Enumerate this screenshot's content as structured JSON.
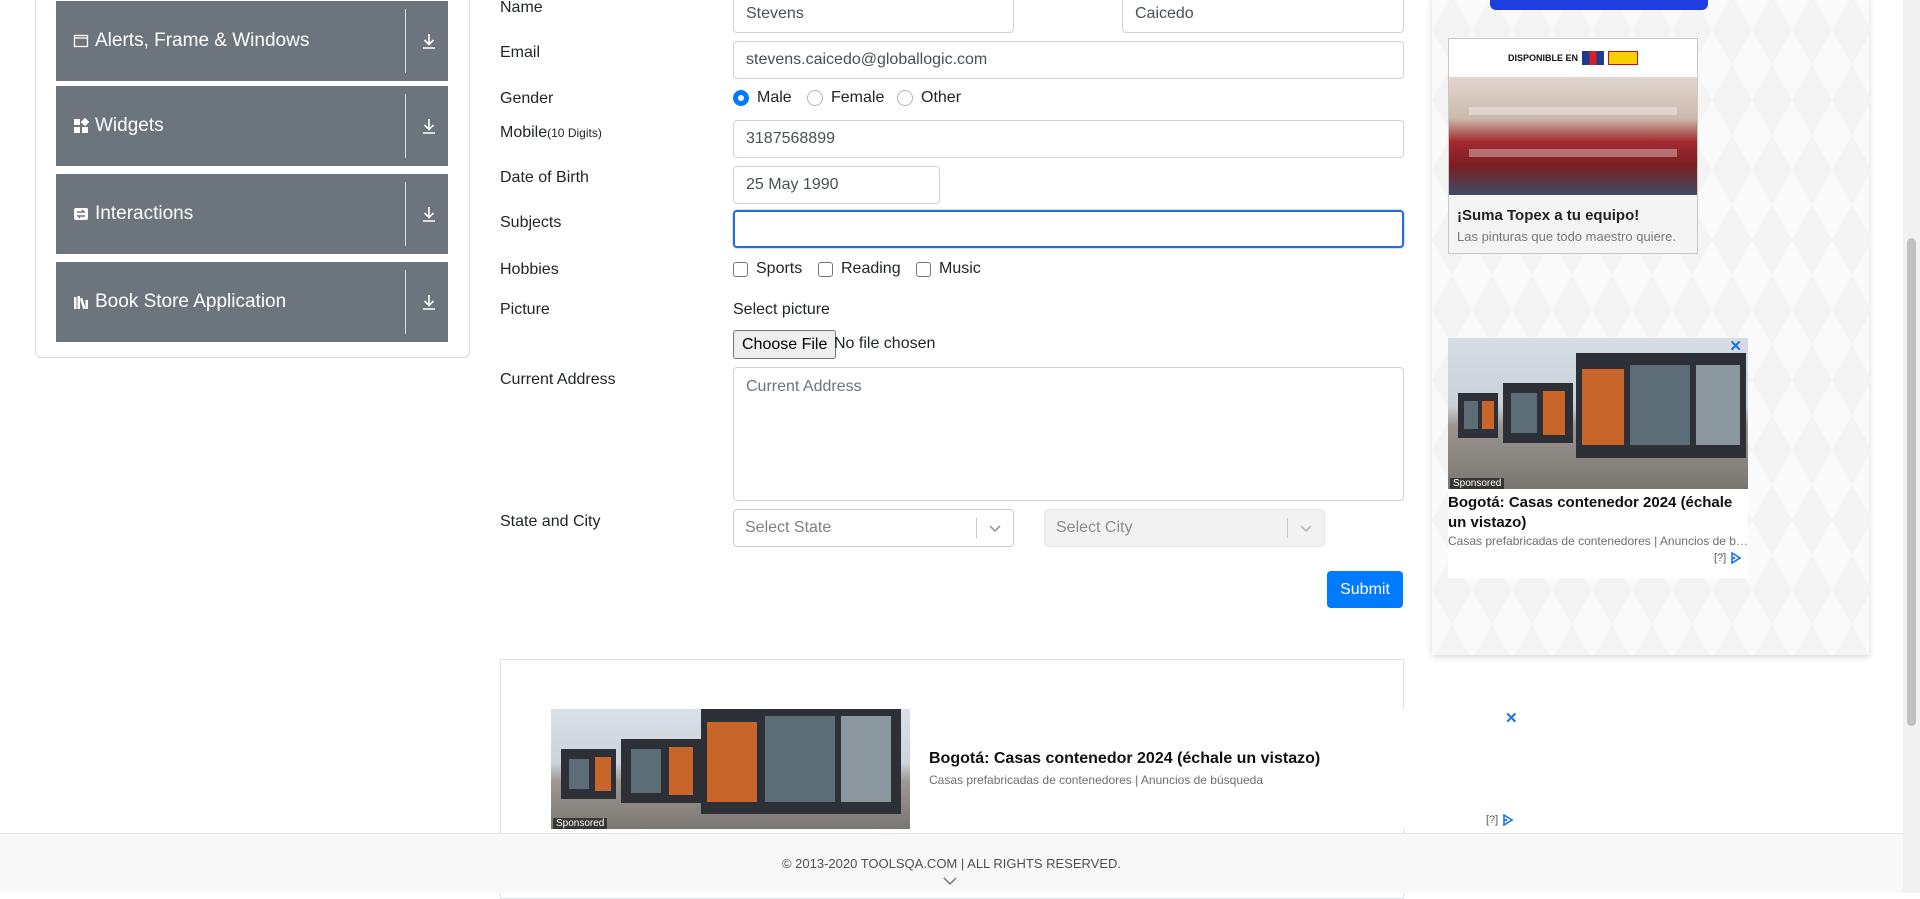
{
  "sidebar": {
    "groups": [
      {
        "label": "Alerts, Frame & Windows",
        "icon": "window-icon"
      },
      {
        "label": "Widgets",
        "icon": "widgets-icon"
      },
      {
        "label": "Interactions",
        "icon": "interactions-icon"
      },
      {
        "label": "Book Store Application",
        "icon": "books-icon"
      }
    ]
  },
  "form": {
    "name_label": "Name",
    "first_name": "Stevens",
    "last_name": "Caicedo",
    "email_label": "Email",
    "email": "stevens.caicedo@globallogic.com",
    "gender_label": "Gender",
    "gender_options": [
      "Male",
      "Female",
      "Other"
    ],
    "gender_selected": "Male",
    "mobile_label": "Mobile",
    "mobile_hint": "(10 Digits)",
    "mobile": "3187568899",
    "dob_label": "Date of Birth",
    "dob": "25 May 1990",
    "subjects_label": "Subjects",
    "subjects_value": "",
    "hobbies_label": "Hobbies",
    "hobbies": [
      "Sports",
      "Reading",
      "Music"
    ],
    "picture_label": "Picture",
    "select_picture": "Select picture",
    "choose_file": "Choose File",
    "no_file": "No file chosen",
    "address_label": "Current Address",
    "address_placeholder": "Current Address",
    "state_city_label": "State and City",
    "state_placeholder": "Select State",
    "city_placeholder": "Select City",
    "submit": "Submit"
  },
  "ads": {
    "topex": {
      "brand_text": "DISPONIBLE EN",
      "brand_logo": "HOMECENTER",
      "brand_logo2": "MALSTRO",
      "title": "¡Suma Topex a tu equipo!",
      "desc": "Las pinturas que todo maestro quiere."
    },
    "container_side": {
      "sponsored": "Sponsored",
      "title": "Bogotá: Casas contenedor 2024 (échale un vistazo)",
      "desc": "Casas prefabricadas de contenedores | Anuncios de búsqueda",
      "info": "[?]"
    },
    "container_bottom": {
      "sponsored": "Sponsored",
      "title": "Bogotá: Casas contenedor 2024 (échale un vistazo)",
      "desc": "Casas prefabricadas de contenedores | Anuncios de búsqueda",
      "info": "[?]"
    },
    "close_symbol": "✕"
  },
  "footer": {
    "copyright": "© 2013-2020 TOOLSQA.COM | ALL RIGHTS RESERVED."
  },
  "colors": {
    "sidebar_group": "#6c757d",
    "primary": "#007bff",
    "ad_close": "#1a73e8"
  }
}
